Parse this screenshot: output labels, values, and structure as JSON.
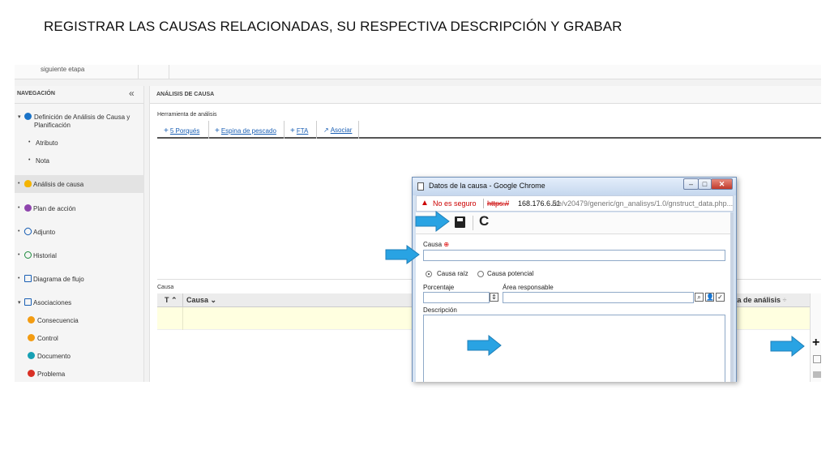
{
  "slide_title": "REGISTRAR LAS CAUSAS RELACIONADAS, SU RESPECTIVA DESCRIPCIÓN Y GRABAR",
  "top_strip": {
    "stage_text": "siguiente etapa"
  },
  "sidebar": {
    "header": "NAVEGACIÓN",
    "collapse_glyph": "«",
    "items": [
      {
        "label": "Definición de Análisis de Causa y",
        "label2": "Planificación",
        "icon": "play-circle-icon",
        "color": "#1a73c8"
      },
      {
        "label": "Atributo",
        "icon": "dot"
      },
      {
        "label": "Nota",
        "icon": "dot"
      },
      {
        "label": "Análisis de causa",
        "icon": "lightbulb-icon",
        "color": "#f4b400"
      },
      {
        "label": "Plan de acción",
        "icon": "cube-icon",
        "color": "#8e44ad"
      },
      {
        "label": "Adjunto",
        "icon": "paperclip-icon",
        "color": "#1a5fb4"
      },
      {
        "label": "Historial",
        "icon": "history-icon",
        "color": "#1b8a3c"
      },
      {
        "label": "Diagrama de flujo",
        "icon": "flowchart-icon",
        "color": "#1a5fb4"
      },
      {
        "label": "Asociaciones",
        "icon": "associations-icon",
        "color": "#1a5fb4"
      },
      {
        "label": "Consecuencia",
        "icon": "consequence-icon",
        "color": "#f39c12"
      },
      {
        "label": "Control",
        "icon": "control-icon",
        "color": "#f39c12"
      },
      {
        "label": "Documento",
        "icon": "document-icon",
        "color": "#16a0b4"
      },
      {
        "label": "Problema",
        "icon": "problem-icon",
        "color": "#d93025"
      }
    ]
  },
  "main": {
    "header": "ANÁLISIS DE CAUSA",
    "tool_label": "Herramienta de análisis",
    "tabs": [
      "5 Porqués",
      "Espina de pescado",
      "FTA",
      "Asociar"
    ],
    "causa_label": "Causa",
    "grid": {
      "col_type": "T",
      "col_causa": "Causa",
      "col_tool_partial": "nta de análisis"
    }
  },
  "popup": {
    "title": "Datos de la causa - Google Chrome",
    "not_secure": "No es seguro",
    "url_protocol": "https://",
    "url_host": "168.176.6.51",
    "url_path": "/se/v20479/generic/gn_analisys/1.0/gnstruct_data.php...",
    "causa_label": "Causa",
    "causa_value": "",
    "radio_root": "Causa raíz",
    "radio_potential": "Causa potencial",
    "radio_selected": "root",
    "percent_label": "Porcentaje",
    "percent_value": "",
    "area_label": "Área responsable",
    "area_value": "",
    "description_label": "Descripción",
    "description_value": ""
  },
  "colors": {
    "arrow": "#29a3e3",
    "arrow_border": "#1f7fb8",
    "highlight_row": "#ffffe0"
  }
}
